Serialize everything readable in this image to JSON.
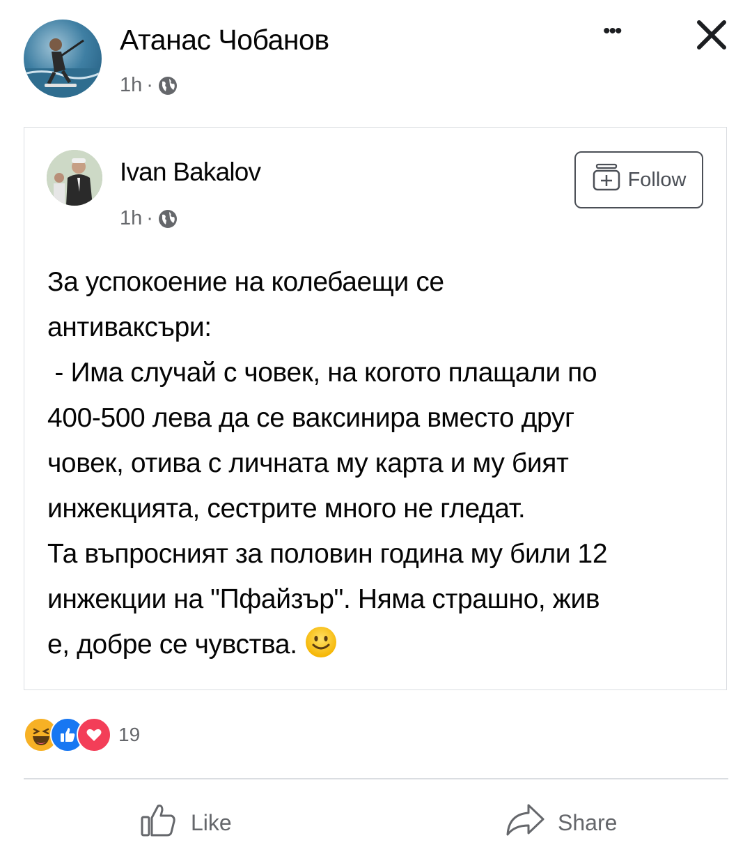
{
  "post": {
    "author": "Атанас Чобанов",
    "time": "1h",
    "separator": "·",
    "privacy_icon": "globe-icon"
  },
  "toolbar": {
    "more_icon": "more-icon",
    "more_glyph": "•••",
    "close_icon": "close-icon"
  },
  "shared_post": {
    "author": "Ivan Bakalov",
    "time": "1h",
    "separator": "·",
    "follow_label": "Follow",
    "text_lines": [
      "За успокоение на колебаещи се",
      "антиваксъри:",
      " - Има случай с човек, на когото плащали по",
      "400-500 лева да се ваксинира вместо друг",
      "човек, отива с личната му карта и му бият",
      "инжекцията, сестрите много не гледат.",
      "Та въпросният за половин година му били 12",
      "инжекции на \"Пфайзър\". Няма страшно, жив",
      "е, добре се чувства."
    ],
    "emoji": "smiling-face-icon"
  },
  "reactions": {
    "icons": [
      "haha-icon",
      "like-icon",
      "love-icon"
    ],
    "count": "19"
  },
  "actions": {
    "like_label": "Like",
    "share_label": "Share"
  },
  "colors": {
    "text": "#050505",
    "secondary": "#65676b",
    "divider": "#dadde1",
    "like_blue": "#1877f2",
    "love_red": "#f33e58",
    "haha_yellow": "#f7b125"
  }
}
